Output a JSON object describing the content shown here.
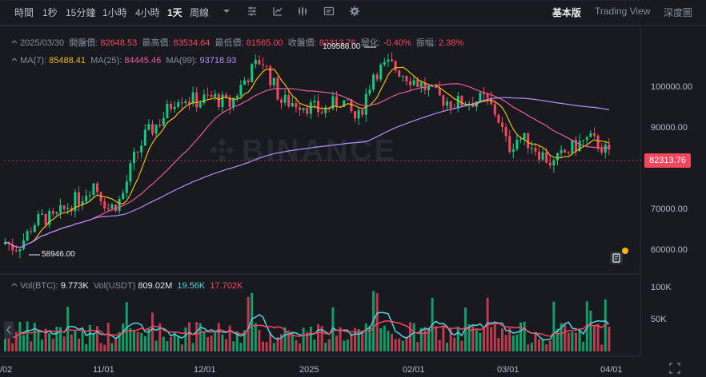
{
  "timeframes": [
    "時間",
    "1秒",
    "15分鐘",
    "1小時",
    "4小時",
    "1天",
    "周線"
  ],
  "active_timeframe": "1天",
  "views": [
    "基本版",
    "Trading View",
    "深度圖"
  ],
  "active_view": "基本版",
  "ohlc": {
    "date": "2025/03/30",
    "open_label": "開盤價:",
    "open": "82648.53",
    "high_label": "最高價:",
    "high": "83534.64",
    "low_label": "最低價:",
    "low": "81565.00",
    "close_label": "收盤價:",
    "close": "82313.76",
    "change_label": "變化:",
    "change": "-0.40%",
    "amp_label": "振幅:",
    "amp": "2.38%"
  },
  "ma": {
    "ma7_label": "MA(7):",
    "ma7": "85488.41",
    "ma25_label": "MA(25):",
    "ma25": "84445.46",
    "ma99_label": "MA(99):",
    "ma99": "93718.93"
  },
  "vol": {
    "btc_label": "Vol(BTC):",
    "btc": "9.773K",
    "usdt_label": "Vol(USDT)",
    "usdt": "809.02M",
    "v1": "19.56K",
    "v2": "17.702K"
  },
  "y_axis": [
    "100000.00",
    "90000.00",
    "70000.00",
    "60000.00"
  ],
  "vol_axis": [
    "100K",
    "50K"
  ],
  "x_axis": [
    "/02",
    "11/01",
    "12/01",
    "2025",
    "02/01",
    "03/01",
    "04/01"
  ],
  "current_price": "82313.76",
  "high_annotation": "109588.00",
  "low_annotation": "58946.00",
  "watermark": "BINANCE",
  "colors": {
    "up": "#0ecb81",
    "down": "#f6465d",
    "ma7": "#f0b90b",
    "ma25": "#e85a9c",
    "ma99": "#b98cff",
    "bg": "#181a20"
  }
}
